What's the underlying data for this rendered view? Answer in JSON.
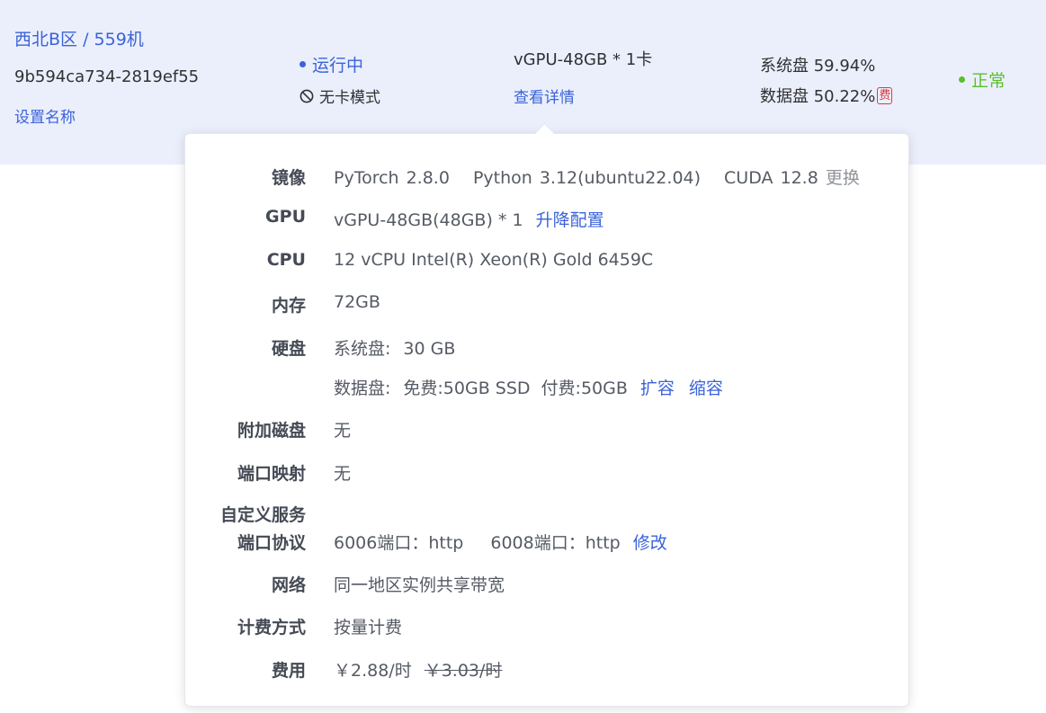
{
  "instance": {
    "region": "西北B区 / 559机",
    "id": "9b594ca734-2819ef55",
    "set_name": "设置名称",
    "status": "运行中",
    "mode": "无卡模式",
    "gpu": "vGPU-48GB * 1卡",
    "view_detail": "查看详情",
    "system_disk": "系统盘 59.94%",
    "data_disk": "数据盘 50.22%",
    "fee_badge": "费",
    "health": "正常"
  },
  "colors": {
    "accent": "#3a63d8",
    "healthy": "#5cbf2a",
    "fee": "#e0393e",
    "row_bg": "#ebeffc"
  },
  "details": {
    "image": {
      "label": "镜像",
      "framework": "PyTorch",
      "framework_version": "2.8.0",
      "python": "Python",
      "python_version": "3.12(ubuntu22.04)",
      "cuda": "CUDA",
      "cuda_version": "12.8",
      "change": "更换"
    },
    "gpu": {
      "label": "GPU",
      "value": "vGPU-48GB(48GB) * 1",
      "upgrade": "升降配置"
    },
    "cpu": {
      "label": "CPU",
      "value": "12 vCPU Intel(R) Xeon(R) Gold 6459C"
    },
    "memory": {
      "label": "内存",
      "value": "72GB"
    },
    "disk": {
      "label": "硬盘",
      "system_label": "系统盘:",
      "system_value": "30 GB",
      "data_label": "数据盘:",
      "data_free": "免费:50GB SSD",
      "data_paid": "付费:50GB",
      "expand": "扩容",
      "shrink": "缩容"
    },
    "extra_disk": {
      "label": "附加磁盘",
      "value": "无"
    },
    "port_mapping": {
      "label": "端口映射",
      "value": "无"
    },
    "custom_service": {
      "label_line1": "自定义服务",
      "label_line2": "端口协议",
      "port1": "6006端口：http",
      "port2": "6008端口：http",
      "edit": "修改"
    },
    "network": {
      "label": "网络",
      "value": "同一地区实例共享带宽"
    },
    "billing": {
      "label": "计费方式",
      "value": "按量计费"
    },
    "cost": {
      "label": "费用",
      "price": "￥2.88/时",
      "original_price": "￥3.03/时"
    }
  }
}
